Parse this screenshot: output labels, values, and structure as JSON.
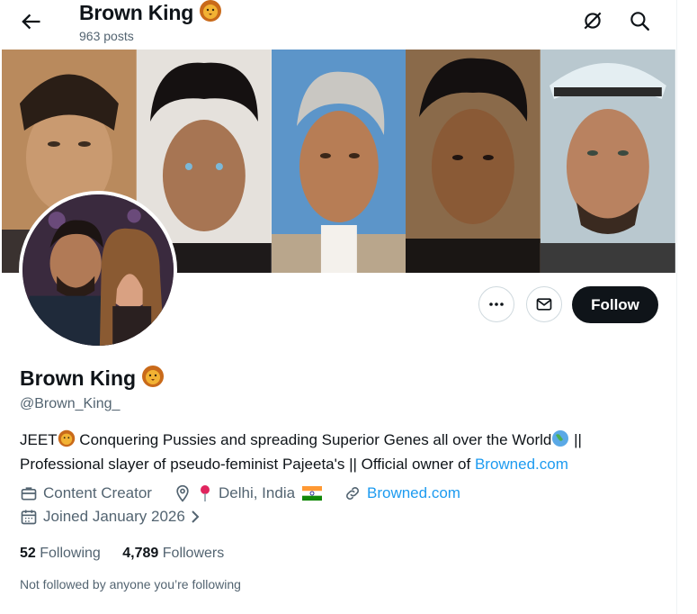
{
  "header": {
    "name": "Brown King",
    "posts": "963 posts"
  },
  "profile": {
    "name": "Brown King",
    "handle": "@Brown_King_",
    "bio_part1": "JEET",
    "bio_part2": " Conquering Pussies and spreading Superior Genes all over the World",
    "bio_part3": " ||",
    "bio_line2": "Professional slayer of pseudo-feminist Pajeeta's || Official owner of ",
    "bio_link": "Browned.com",
    "category": "Content Creator",
    "location": "Delhi, India",
    "website": "Browned.com",
    "joined": "Joined January 2026",
    "following_count": "52",
    "following_label": " Following",
    "followers_count": "4,789",
    "followers_label": " Followers",
    "not_followed": "Not followed by anyone you’re following"
  },
  "actions": {
    "follow": "Follow"
  },
  "icons": {
    "back": "back-arrow-icon",
    "grok": "grok-icon",
    "search": "search-icon",
    "more": "more-icon",
    "message": "message-icon",
    "category": "briefcase-icon",
    "location": "location-icon",
    "website": "link-icon",
    "joined": "calendar-icon"
  },
  "colors": {
    "accent": "#1d9bf0",
    "text": "#0f1419",
    "muted": "#536471",
    "follow_bg": "#0f1419"
  }
}
